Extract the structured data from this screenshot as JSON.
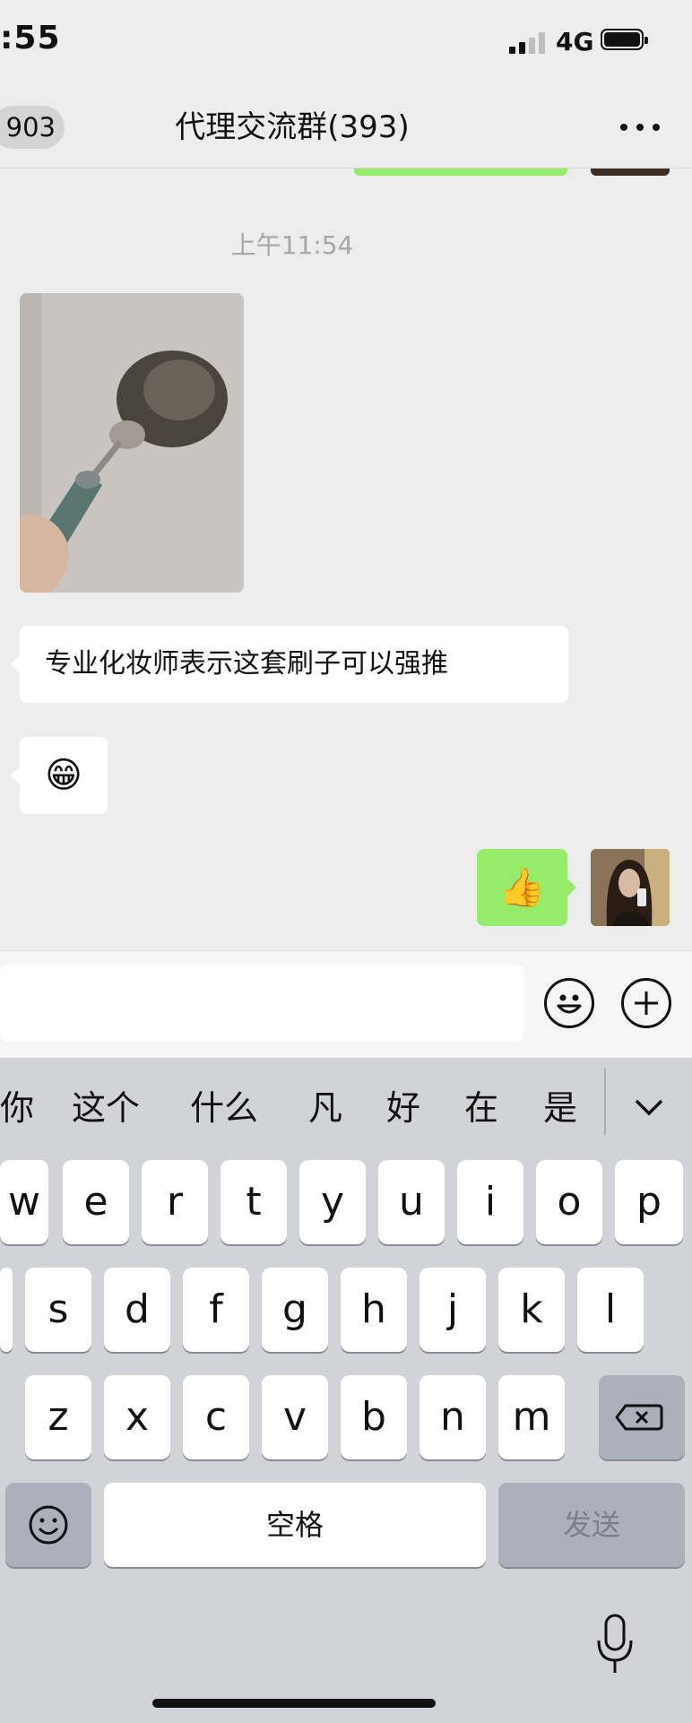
{
  "status_bar": {
    "time": ":55",
    "network": "4G"
  },
  "header": {
    "back_count": "903",
    "title": "代理交流群(393)"
  },
  "chat": {
    "timestamp": "上午11:54",
    "text_message": "专业化妆师表示这套刷子可以强推",
    "emoji_message": "😁",
    "my_message": "👍"
  },
  "keyboard": {
    "candidates": [
      "你",
      "这个",
      "什么",
      "凡",
      "好",
      "在",
      "是"
    ],
    "row1": [
      "w",
      "e",
      "r",
      "t",
      "y",
      "u",
      "i",
      "o",
      "p"
    ],
    "row2": [
      "s",
      "d",
      "f",
      "g",
      "h",
      "j",
      "k",
      "l"
    ],
    "row3": [
      "z",
      "x",
      "c",
      "v",
      "b",
      "n",
      "m"
    ],
    "space_label": "空格",
    "send_label": "发送"
  },
  "colors": {
    "accent_green": "#95ec69",
    "background": "#ededed",
    "keyboard": "#d2d3d9"
  },
  "icons": [
    "more-icon",
    "emoji-icon",
    "plus-icon",
    "chevron-down-icon",
    "delete-icon",
    "emoji-key-icon",
    "mic-icon"
  ]
}
